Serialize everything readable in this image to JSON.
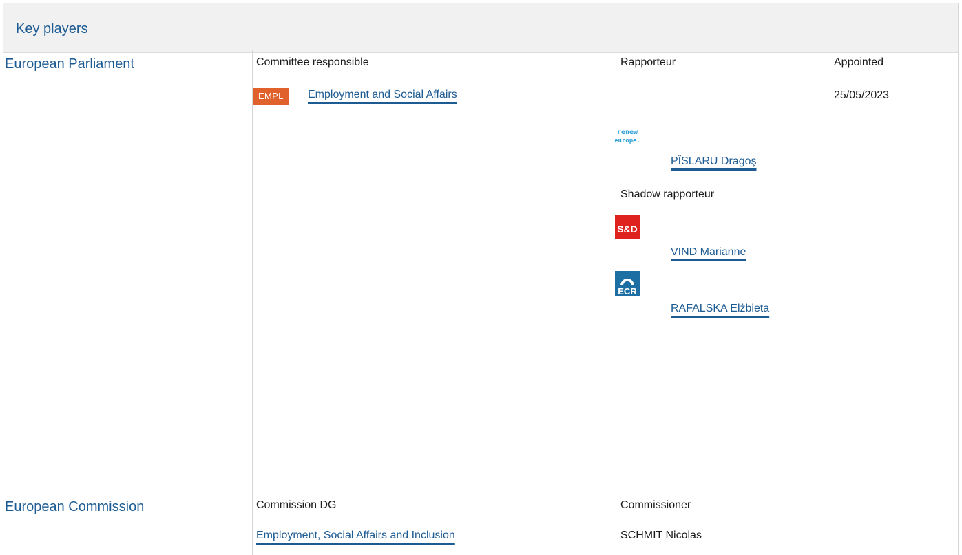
{
  "header": {
    "title": "Key players"
  },
  "parliament": {
    "name": "European Parliament",
    "committee_label": "Committee responsible",
    "rapporteur_label": "Rapporteur",
    "appointed_label": "Appointed",
    "committee_badge": "EMPL",
    "committee_name": "Employment and Social Affairs",
    "appointed_date": "25/05/2023",
    "rapporteur": {
      "name": "PÎSLARU Dragoş",
      "group_logo": "renew-europe-logo"
    },
    "shadow_label": "Shadow rapporteur",
    "shadows": [
      {
        "name": "VIND Marianne",
        "group_logo": "sd-logo"
      },
      {
        "name": "RAFALSKA Elżbieta",
        "group_logo": "ecr-logo"
      }
    ]
  },
  "commission": {
    "name": "European Commission",
    "dg_label": "Commission DG",
    "commissioner_label": "Commissioner",
    "dg_name": "Employment, Social Affairs and Inclusion",
    "commissioner_name": "SCHMIT Nicolas"
  },
  "colors": {
    "link": "#1d5b93",
    "badge": "#e1612d",
    "sd_red": "#e0221f",
    "ecr_blue": "#1d6fa3",
    "header_bg": "#f1f1f1"
  }
}
